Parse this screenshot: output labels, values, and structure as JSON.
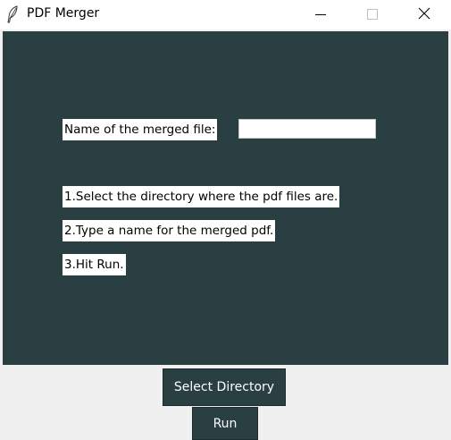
{
  "window": {
    "title": "PDF Merger",
    "icon": "feather-icon"
  },
  "titlebar_controls": {
    "minimize": "minimize-icon",
    "maximize": "maximize-icon",
    "close": "close-icon"
  },
  "form": {
    "name_label": "Name of the merged file:",
    "name_value": "",
    "name_placeholder": ""
  },
  "instructions": [
    "1.Select the directory where the pdf files are.",
    "2.Type a name for the merged pdf.",
    "3.Hit Run."
  ],
  "buttons": {
    "select_directory": "Select Directory",
    "run": "Run"
  },
  "colors": {
    "panel_background": "#2a3f42",
    "window_background": "#f0f0f0",
    "button_background": "#2a3f42",
    "button_text": "#ffffff"
  }
}
